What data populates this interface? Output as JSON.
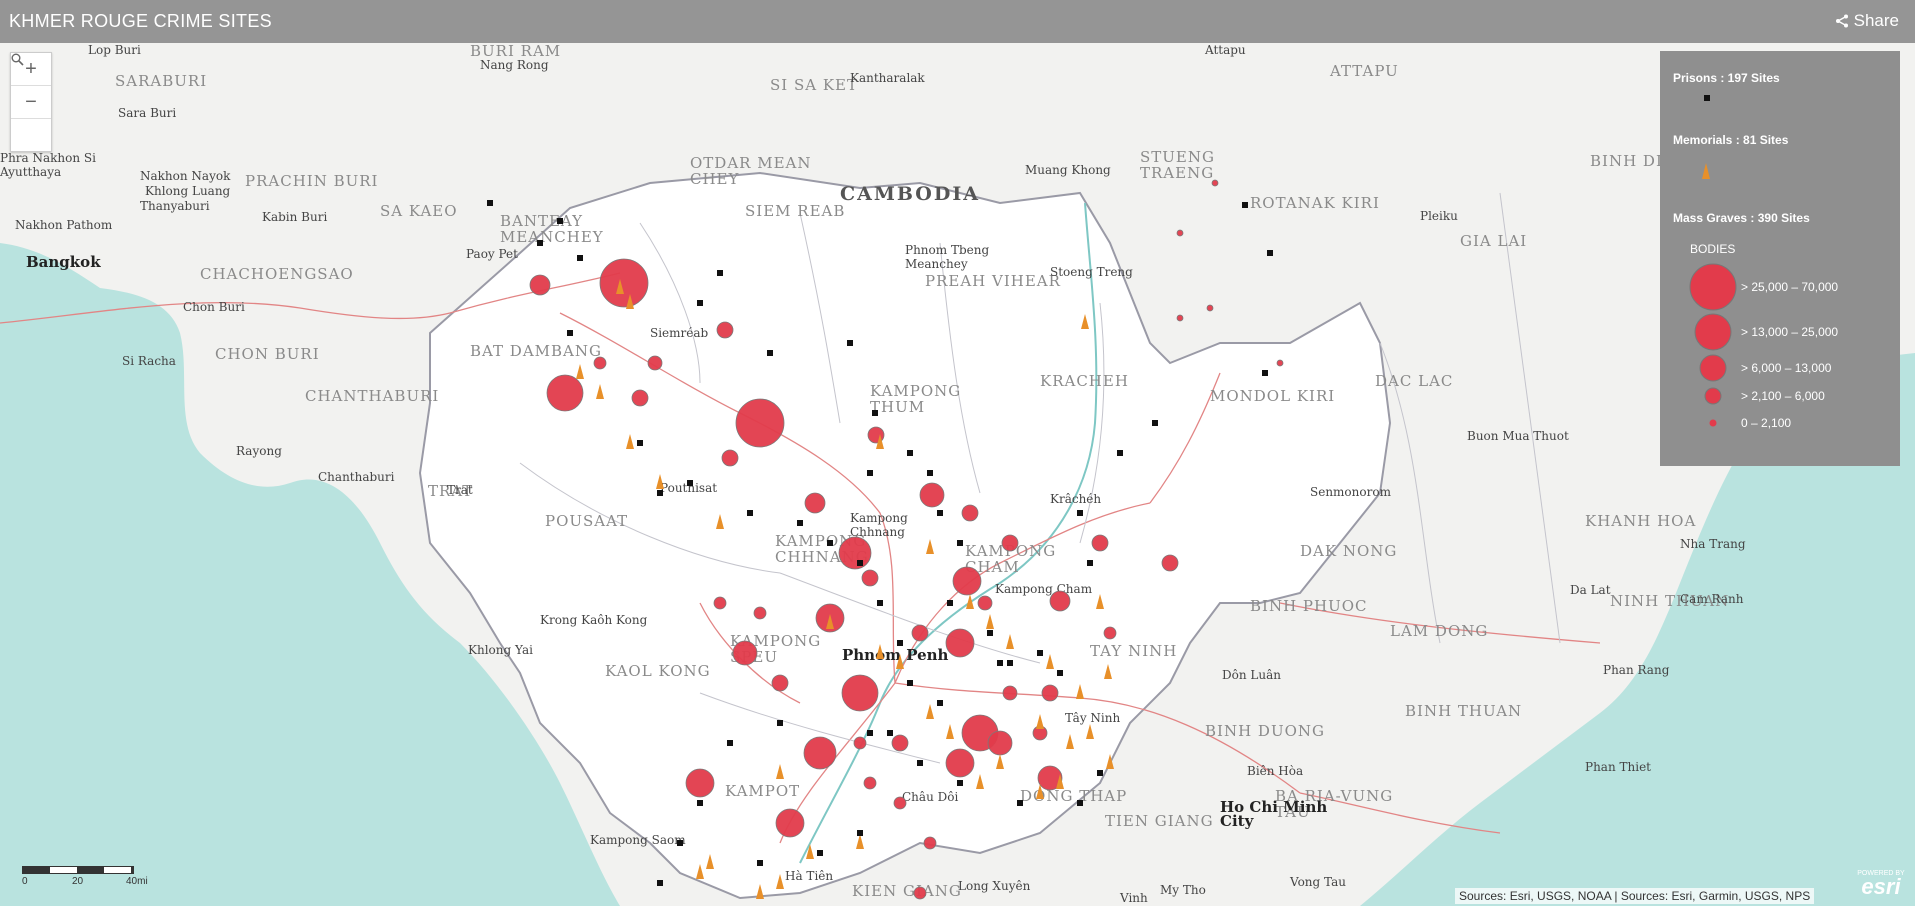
{
  "header": {
    "title": "KHMER ROUGE CRIME SITES",
    "share_label": "Share"
  },
  "zoom": {
    "in_label": "+",
    "out_label": "−",
    "search_label": "⚲"
  },
  "legend": {
    "prisons": "Prisons : 197 Sites",
    "memorials": "Memorials : 81 Sites",
    "mass_graves": "Mass Graves : 390 Sites",
    "bodies_title": "BODIES",
    "classes": [
      "> 25,000 – 70,000",
      "> 13,000 – 25,000",
      "> 6,000 – 13,000",
      "> 2,100 – 6,000",
      "0 – 2,100"
    ],
    "colors": {
      "grave": "#e23b4b",
      "prison": "#111111",
      "memorial": "#e8902a",
      "panel": "#8f8f8f"
    }
  },
  "scale": {
    "labels": [
      "0",
      "20",
      "40mi"
    ]
  },
  "attribution": "Sources: Esri, USGS, NOAA | Sources: Esri, Garmin, USGS, NPS",
  "esri": {
    "powered": "POWERED BY",
    "name": "esri"
  },
  "labels": {
    "countries": [
      "CAMBODIA"
    ],
    "provinces": [
      "BURI RAM",
      "SI SA KET",
      "OTDAR MEAN CHEY",
      "BANTEAY MEANCHEY",
      "SA KAEO",
      "PRACHIN BURI",
      "SARABURI",
      "SIEM REAB",
      "PREAH VIHEAR",
      "STUENG TRAENG",
      "ROTANAK KIRI",
      "ATTAPU",
      "GIA LAI",
      "BINH DINH",
      "CHACHOENGSAO",
      "CHON BURI",
      "CHANTHABURI",
      "BAT DAMBANG",
      "KAMPONG THUM",
      "KRACHEH",
      "MONDOL KIRI",
      "DAC LAC",
      "POUSAAT",
      "TRAT",
      "KAMPONG CHHNANG",
      "KAMPONG CHAM",
      "DAK NONG",
      "KHANH HOA",
      "KAMPONG SPEU",
      "KAOL KONG",
      "TAY NINH",
      "BINH PHUOC",
      "LAM DONG",
      "NINH THUAN",
      "KAMPOT",
      "BINH DUONG",
      "BINH THUAN",
      "DONG THAP",
      "TIEN GIANG",
      "BA RIA-VUNG TAU",
      "KIEN GIANG"
    ],
    "places": [
      "Lop Buri",
      "Nang Rong",
      "Kantharalak",
      "Attapu",
      "Sara Buri",
      "Phra Nakhon Si Ayutthaya",
      "Nakhon Nayok",
      "Khlong Luang",
      "Thanyaburi",
      "Kabin Buri",
      "Nakhon Pathom",
      "Bangkok",
      "Muang Khong",
      "Pleiku",
      "Phnom Tbeng Meanchey",
      "Stoeng Treng",
      "Paoy Pet",
      "Siemréab",
      "Chon Buri",
      "Si Racha",
      "Rayong",
      "Chanthaburi",
      "Pouthisat",
      "Kampong Chhnang",
      "Krâchéh",
      "Buon Mua Thuot",
      "Senmonorom",
      "Kampong Cham",
      "Trat",
      "Nha Trang",
      "Cam Ranh",
      "Da Lat",
      "Krong Kaôh Kong",
      "Khlong Yai",
      "Phnom Penh",
      "Dôn Luân",
      "Tây Ninh",
      "Phan Rang",
      "Biên Hòa",
      "Ho Chi Minh City",
      "Phan Thiet",
      "Châu Dôi",
      "Kampong Saom",
      "Hà Tiên",
      "Long Xuyên",
      "Vinh",
      "My Tho",
      "Vong Tau"
    ]
  }
}
